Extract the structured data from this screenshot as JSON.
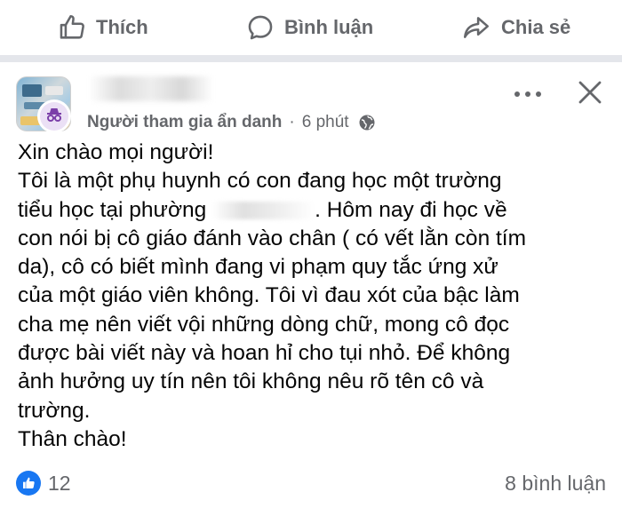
{
  "actions": {
    "like_label": "Thích",
    "comment_label": "Bình luận",
    "share_label": "Chia sẻ"
  },
  "post": {
    "author_role": "Người tham gia ẩn danh",
    "time": "6 phút",
    "lines": [
      "Xin chào mọi người!",
      "Tôi là một phụ huynh có con đang học một trường",
      "tiểu học tại phường",
      ". Hôm nay đi học về",
      "con nói bị cô giáo đánh vào chân ( có vết lằn còn tím",
      "da), cô có biết mình đang vi phạm quy tắc ứng xử",
      "của một giáo viên không. Tôi vì đau xót của bậc làm",
      "cha mẹ nên viết vội những dòng chữ, mong cô đọc",
      "được bài viết này và hoan hỉ cho tụi nhỏ. Để không",
      "ảnh hưởng uy tín nên tôi không nêu rõ tên cô và",
      "trường.",
      "Thân chào!"
    ],
    "like_count": "12",
    "comment_count": "8 bình luận"
  },
  "colors": {
    "accent": "#1877f2",
    "secondary_text": "#65676b",
    "separator": "#e4e6eb",
    "anon_badge_bg": "#ebe0f5"
  },
  "icons": {
    "like": "thumbs-up-icon",
    "comment": "speech-bubble-icon",
    "share": "share-arrow-icon",
    "more": "more-horizontal-icon",
    "close": "close-icon",
    "privacy": "globe-icon",
    "anonymous": "incognito-icon"
  }
}
